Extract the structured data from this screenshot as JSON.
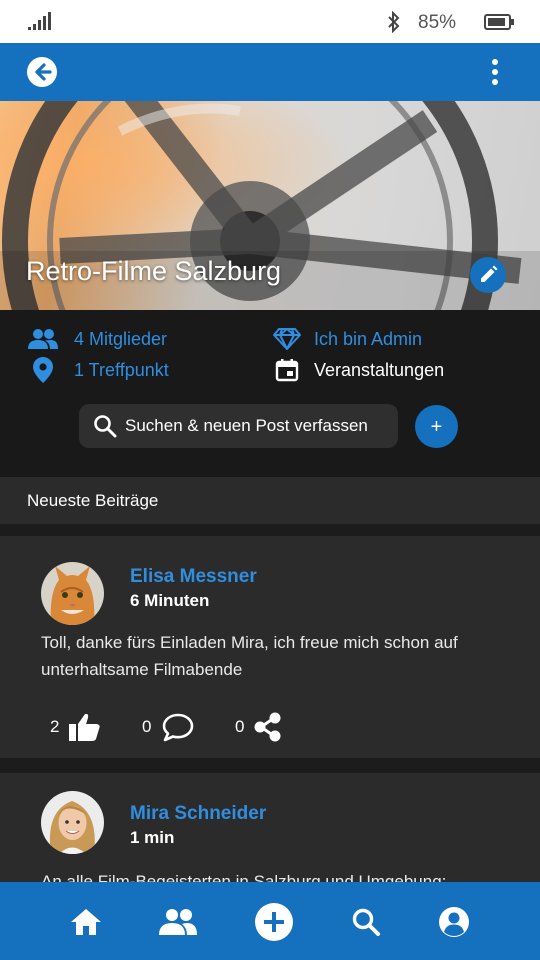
{
  "status_bar": {
    "battery_percent": "85%",
    "icons": [
      "signal-icon",
      "bluetooth-icon",
      "battery-icon"
    ]
  },
  "app_bar": {
    "icons": [
      "back-arrow-icon",
      "more-vert-icon"
    ]
  },
  "group": {
    "title": "Retro-Filme Salzburg",
    "members_label": "4 Mitglieder",
    "admin_label": "Ich bin Admin",
    "meeting_points_label": "1 Treffpunkt",
    "events_label": "Veranstaltungen"
  },
  "search": {
    "label": "Suchen & neuen Post verfassen",
    "add_label": "+"
  },
  "feed": {
    "section_title": "Neueste Beiträge",
    "posts": [
      {
        "author": "Elisa Messner",
        "time": "6 Minuten",
        "text": "Toll, danke fürs Einladen Mira, ich freue mich schon auf unterhaltsame Filmabende",
        "likes": "2",
        "comments": "0",
        "shares": "0"
      },
      {
        "author": "Mira Schneider",
        "time": "1 min",
        "text": "An alle Film-Begeisterten in Salzburg und Umgebung:"
      }
    ]
  },
  "bottom_nav": {
    "items": [
      "home-icon",
      "group-icon",
      "add-circle-icon",
      "search-icon",
      "account-icon"
    ]
  },
  "colors": {
    "primary": "#1570bd",
    "link_blue": "#2f8ee0",
    "background": "#1c1c1c",
    "card": "#2b2b2b"
  }
}
